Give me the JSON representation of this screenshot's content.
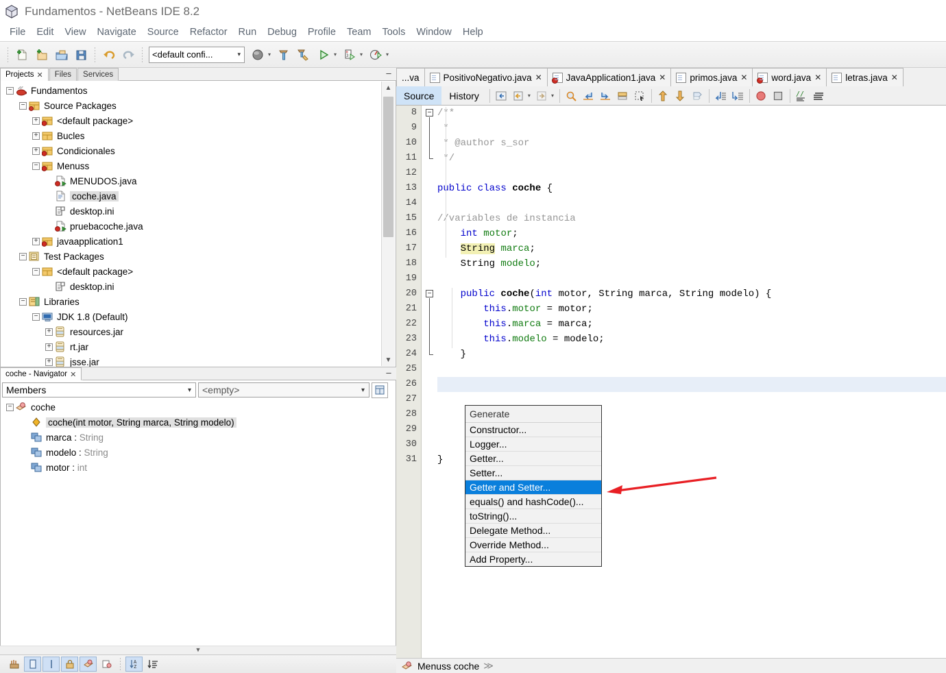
{
  "window": {
    "title": "Fundamentos - NetBeans IDE 8.2",
    "app_icon": "netbeans-cube-icon"
  },
  "menubar": {
    "items": [
      "File",
      "Edit",
      "View",
      "Navigate",
      "Source",
      "Refactor",
      "Run",
      "Debug",
      "Profile",
      "Team",
      "Tools",
      "Window",
      "Help"
    ]
  },
  "toolbar": {
    "buttons": [
      {
        "name": "new-file-icon",
        "label": "New File"
      },
      {
        "name": "new-project-icon",
        "label": "New Project"
      },
      {
        "name": "open-project-icon",
        "label": "Open Project"
      },
      {
        "name": "save-all-icon",
        "label": "Save All"
      },
      {
        "name": "undo-icon",
        "label": "Undo"
      },
      {
        "name": "redo-icon",
        "label": "Redo"
      }
    ],
    "config_combo_value": "<default confi...",
    "right_buttons": [
      {
        "name": "set-browser-icon",
        "label": "Set Browser"
      },
      {
        "name": "build-project-icon",
        "label": "Build Project"
      },
      {
        "name": "clean-build-icon",
        "label": "Clean and Build Project"
      },
      {
        "name": "run-project-icon",
        "label": "Run Project"
      },
      {
        "name": "debug-project-icon",
        "label": "Debug Project"
      },
      {
        "name": "profile-project-icon",
        "label": "Profile Project"
      }
    ]
  },
  "projects_window": {
    "tabs": [
      {
        "label": "Projects",
        "active": true,
        "closable": true
      },
      {
        "label": "Files",
        "active": false,
        "closable": false
      },
      {
        "label": "Services",
        "active": false,
        "closable": false
      }
    ],
    "minimize_glyph": "–",
    "tree": [
      {
        "label": "Fundamentos",
        "depth": 0,
        "expander": "-",
        "icon": "java-project-icon",
        "selected": false
      },
      {
        "label": "Source Packages",
        "depth": 1,
        "expander": "-",
        "icon": "source-packages-icon",
        "selected": false
      },
      {
        "label": "<default package>",
        "depth": 2,
        "expander": "+",
        "icon": "package-error-icon",
        "selected": false
      },
      {
        "label": "Bucles",
        "depth": 2,
        "expander": "+",
        "icon": "package-icon",
        "selected": false
      },
      {
        "label": "Condicionales",
        "depth": 2,
        "expander": "+",
        "icon": "package-error-icon",
        "selected": false
      },
      {
        "label": "Menuss",
        "depth": 2,
        "expander": "-",
        "icon": "package-error-icon",
        "selected": false
      },
      {
        "label": "MENUDOS.java",
        "depth": 3,
        "expander": "",
        "icon": "java-main-file-icon",
        "selected": false
      },
      {
        "label": "coche.java",
        "depth": 3,
        "expander": "",
        "icon": "java-file-icon",
        "selected": true
      },
      {
        "label": "desktop.ini",
        "depth": 3,
        "expander": "",
        "icon": "ini-file-icon",
        "selected": false
      },
      {
        "label": "pruebacoche.java",
        "depth": 3,
        "expander": "",
        "icon": "java-main-file-icon",
        "selected": false
      },
      {
        "label": "javaapplication1",
        "depth": 2,
        "expander": "+",
        "icon": "package-error-icon",
        "selected": false
      },
      {
        "label": "Test Packages",
        "depth": 1,
        "expander": "-",
        "icon": "test-packages-icon",
        "selected": false
      },
      {
        "label": "<default package>",
        "depth": 2,
        "expander": "-",
        "icon": "test-package-icon",
        "selected": false
      },
      {
        "label": "desktop.ini",
        "depth": 3,
        "expander": "",
        "icon": "ini-file-icon",
        "selected": false
      },
      {
        "label": "Libraries",
        "depth": 1,
        "expander": "-",
        "icon": "libraries-icon",
        "selected": false
      },
      {
        "label": "JDK 1.8 (Default)",
        "depth": 2,
        "expander": "-",
        "icon": "jdk-icon",
        "selected": false
      },
      {
        "label": "resources.jar",
        "depth": 3,
        "expander": "+",
        "icon": "jar-icon",
        "selected": false
      },
      {
        "label": "rt.jar",
        "depth": 3,
        "expander": "+",
        "icon": "jar-icon",
        "selected": false
      },
      {
        "label": "jsse.jar",
        "depth": 3,
        "expander": "+",
        "icon": "jar-icon",
        "selected": false
      }
    ]
  },
  "navigator_window": {
    "tab_label": "coche - Navigator",
    "minimize_glyph": "–",
    "view_combo_value": "Members",
    "filter_combo_value": "<empty>",
    "inspect_button": "inspect-members-icon",
    "tree": [
      {
        "label": "coche",
        "type": "",
        "depth": 0,
        "expander": "-",
        "icon": "class-icon",
        "selected": false
      },
      {
        "label": "coche(int motor, String marca, String modelo)",
        "type": "",
        "depth": 1,
        "expander": "",
        "icon": "constructor-icon",
        "selected": true
      },
      {
        "label": "marca",
        "type": "String",
        "depth": 1,
        "expander": "",
        "icon": "field-icon",
        "selected": false
      },
      {
        "label": "modelo",
        "type": "String",
        "depth": 1,
        "expander": "",
        "icon": "field-icon",
        "selected": false
      },
      {
        "label": "motor",
        "type": "int",
        "depth": 1,
        "expander": "",
        "icon": "field-icon",
        "selected": false
      }
    ],
    "footer_buttons": [
      {
        "name": "show-inherited-members-icon",
        "active": false
      },
      {
        "name": "show-fields-icon",
        "active": true
      },
      {
        "name": "show-constructors-icon",
        "active": true
      },
      {
        "name": "show-non-public-icon",
        "active": true
      },
      {
        "name": "show-static-icon",
        "active": true
      },
      {
        "name": "show-inner-classes-icon",
        "active": false
      },
      {
        "name": "sort-alphabetically-icon",
        "active": true
      },
      {
        "name": "sort-by-source-icon",
        "active": false
      }
    ],
    "collapse_glyph": "▼"
  },
  "editor": {
    "tabs": [
      {
        "label": "...va",
        "icon": "java-file-icon",
        "active": false,
        "clipped": true,
        "closable": false
      },
      {
        "label": "PositivoNegativo.java",
        "icon": "java-file-icon",
        "active": false,
        "clipped": false,
        "closable": true
      },
      {
        "label": "JavaApplication1.java",
        "icon": "java-error-file-icon",
        "active": false,
        "clipped": false,
        "closable": true
      },
      {
        "label": "primos.java",
        "icon": "java-file-icon",
        "active": false,
        "clipped": false,
        "closable": true
      },
      {
        "label": "word.java",
        "icon": "java-error-file-icon",
        "active": false,
        "clipped": false,
        "closable": true
      },
      {
        "label": "letras.java",
        "icon": "java-file-icon",
        "active": false,
        "clipped": false,
        "closable": true
      }
    ],
    "view_buttons": [
      {
        "label": "Source",
        "active": true
      },
      {
        "label": "History",
        "active": false
      }
    ],
    "toolbar_icons": [
      "last-edit-position-icon",
      "back-icon",
      "forward-icon",
      "find-selection-icon",
      "find-previous-icon",
      "find-next-icon",
      "toggle-highlight-icon",
      "toggle-rectangular-selection-icon",
      "previous-bookmark-icon",
      "next-bookmark-icon",
      "toggle-bookmark-icon",
      "shift-line-left-icon",
      "shift-line-right-icon",
      "toggle-breakpoint-icon",
      "stop-icon",
      "comment-icon",
      "uncomment-icon"
    ],
    "first_line_number": 8,
    "caret_line": 26,
    "lines": [
      {
        "n": 8,
        "segments": [
          {
            "t": "/**",
            "c": "cm"
          }
        ],
        "fold": "start"
      },
      {
        "n": 9,
        "segments": [
          {
            "t": " *",
            "c": "cm"
          }
        ]
      },
      {
        "n": 10,
        "segments": [
          {
            "t": " * @author s_sor",
            "c": "cm"
          }
        ]
      },
      {
        "n": 11,
        "segments": [
          {
            "t": " */",
            "c": "cm"
          }
        ],
        "fold": "end"
      },
      {
        "n": 12,
        "segments": []
      },
      {
        "n": 13,
        "segments": [
          {
            "t": "public class ",
            "c": "kw"
          },
          {
            "t": "coche",
            "c": "bold"
          },
          {
            "t": " {",
            "c": ""
          }
        ]
      },
      {
        "n": 14,
        "segments": []
      },
      {
        "n": 15,
        "segments": [
          {
            "t": "//variables de instancia",
            "c": "cm"
          }
        ]
      },
      {
        "n": 16,
        "segments": [
          {
            "t": "    ",
            "c": ""
          },
          {
            "t": "int",
            "c": "kw"
          },
          {
            "t": " ",
            "c": ""
          },
          {
            "t": "motor",
            "c": "fld"
          },
          {
            "t": ";",
            "c": ""
          }
        ]
      },
      {
        "n": 17,
        "segments": [
          {
            "t": "    ",
            "c": ""
          },
          {
            "t": "String",
            "c": "hl"
          },
          {
            "t": " ",
            "c": ""
          },
          {
            "t": "marca",
            "c": "fld"
          },
          {
            "t": ";",
            "c": ""
          }
        ]
      },
      {
        "n": 18,
        "segments": [
          {
            "t": "    String ",
            "c": ""
          },
          {
            "t": "modelo",
            "c": "fld"
          },
          {
            "t": ";",
            "c": ""
          }
        ]
      },
      {
        "n": 19,
        "segments": []
      },
      {
        "n": 20,
        "segments": [
          {
            "t": "    ",
            "c": ""
          },
          {
            "t": "public ",
            "c": "kw"
          },
          {
            "t": "coche",
            "c": "bold"
          },
          {
            "t": "(",
            "c": ""
          },
          {
            "t": "int",
            "c": "kw"
          },
          {
            "t": " motor, String marca, String modelo) {",
            "c": ""
          }
        ],
        "fold": "start"
      },
      {
        "n": 21,
        "segments": [
          {
            "t": "        ",
            "c": ""
          },
          {
            "t": "this",
            "c": "kw"
          },
          {
            "t": ".",
            "c": ""
          },
          {
            "t": "motor",
            "c": "fld"
          },
          {
            "t": " = motor;",
            "c": ""
          }
        ]
      },
      {
        "n": 22,
        "segments": [
          {
            "t": "        ",
            "c": ""
          },
          {
            "t": "this",
            "c": "kw"
          },
          {
            "t": ".",
            "c": ""
          },
          {
            "t": "marca",
            "c": "fld"
          },
          {
            "t": " = marca;",
            "c": ""
          }
        ]
      },
      {
        "n": 23,
        "segments": [
          {
            "t": "        ",
            "c": ""
          },
          {
            "t": "this",
            "c": "kw"
          },
          {
            "t": ".",
            "c": ""
          },
          {
            "t": "modelo",
            "c": "fld"
          },
          {
            "t": " = modelo;",
            "c": ""
          }
        ]
      },
      {
        "n": 24,
        "segments": [
          {
            "t": "    }",
            "c": ""
          }
        ],
        "fold": "end"
      },
      {
        "n": 25,
        "segments": []
      },
      {
        "n": 26,
        "segments": []
      },
      {
        "n": 27,
        "segments": []
      },
      {
        "n": 28,
        "segments": []
      },
      {
        "n": 29,
        "segments": []
      },
      {
        "n": 30,
        "segments": []
      },
      {
        "n": 31,
        "segments": [
          {
            "t": "}",
            "c": ""
          }
        ]
      }
    ],
    "status_path": "Menuss coche",
    "status_icon": "class-icon",
    "status_separator": "≫"
  },
  "generate_menu": {
    "header": "Generate",
    "items": [
      {
        "label": "Constructor...",
        "selected": false
      },
      {
        "label": "Logger...",
        "selected": false
      },
      {
        "label": "Getter...",
        "selected": false
      },
      {
        "label": "Setter...",
        "selected": false
      },
      {
        "label": "Getter and Setter...",
        "selected": true
      },
      {
        "label": "equals() and hashCode()...",
        "selected": false
      },
      {
        "label": "toString()...",
        "selected": false
      },
      {
        "label": "Delegate Method...",
        "selected": false
      },
      {
        "label": "Override Method...",
        "selected": false
      },
      {
        "label": "Add Property...",
        "selected": false
      }
    ]
  },
  "annotation": {
    "type": "red-arrow",
    "color": "#e81f24",
    "points_to": "Getter and Setter..."
  },
  "colors": {
    "selection_blue": "#0a7fdc",
    "caret_line": "#e7eef8",
    "keyword": "#0000cc",
    "field": "#0f7a0f",
    "comment": "#969696",
    "highlight_yellow": "#f2f0b4",
    "annotation_red": "#e81f24"
  }
}
